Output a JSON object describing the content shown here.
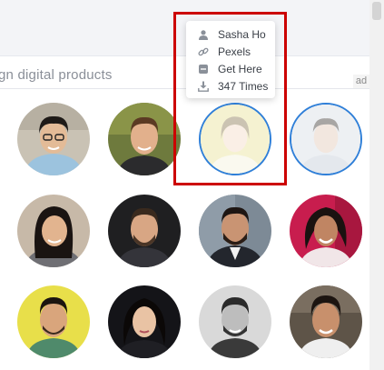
{
  "search": {
    "text": "gn digital products"
  },
  "ad_badge": "ad",
  "tooltip": {
    "author": {
      "icon": "user-icon",
      "text": "Sasha Ho"
    },
    "source": {
      "icon": "link-icon",
      "text": "Pexels"
    },
    "action": {
      "icon": "download-link-icon",
      "text": "Get Here"
    },
    "downloads": {
      "icon": "download-icon",
      "text": "347 Times"
    }
  },
  "colors": {
    "highlight": "#cc0000",
    "selected_ring": "#2f7fd8",
    "topbar": "#f3f4f7"
  }
}
